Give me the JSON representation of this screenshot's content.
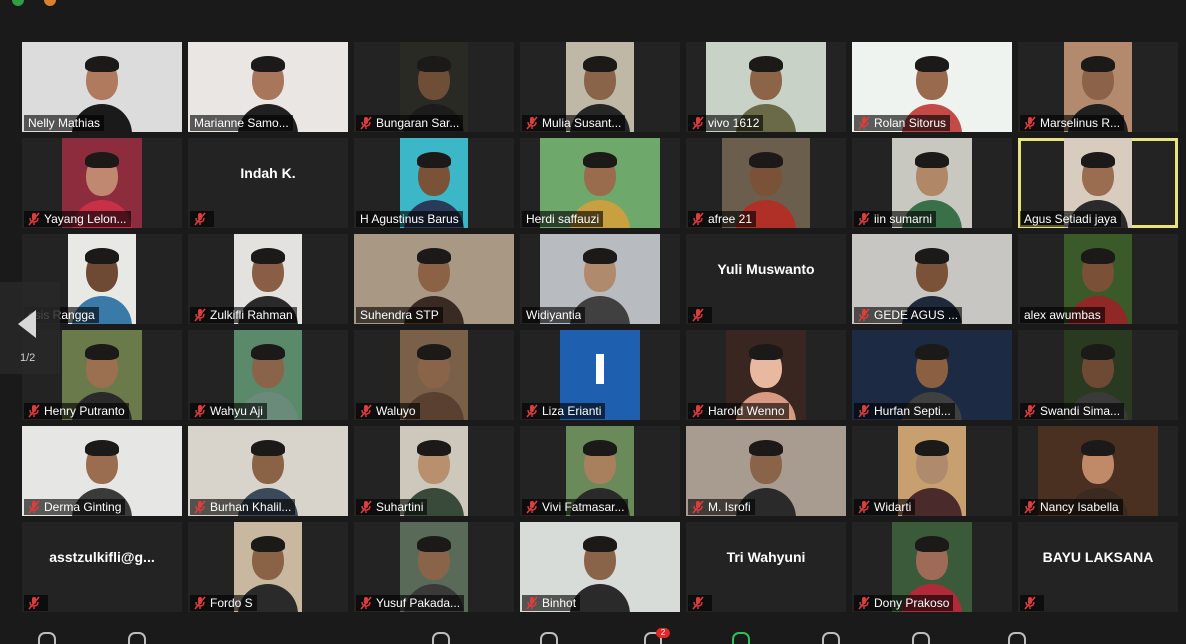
{
  "meeting": {
    "page_indicator": "1/2",
    "badge_count": "2",
    "participants": [
      {
        "name": "Nelly Mathias",
        "muted": false,
        "video": true,
        "bg": "#dcdcdc",
        "skin": "#b07a5e",
        "shirt": "#1a1a1a"
      },
      {
        "name": "Marianne Samo...",
        "muted": false,
        "video": true,
        "bg": "#e9e6e4",
        "skin": "#a8765a",
        "shirt": "#202020"
      },
      {
        "name": "Bungaran Sar...",
        "muted": true,
        "video": true,
        "bg": "#2a2a24",
        "skin": "#6e4e36",
        "shirt": "#1c1c1c"
      },
      {
        "name": "Mulia Susant...",
        "muted": true,
        "video": true,
        "bg": "#bfb8a6",
        "skin": "#8a6448",
        "shirt": "#262626"
      },
      {
        "name": "vivo 1612",
        "muted": true,
        "video": true,
        "bg": "#c9d2c6",
        "skin": "#8c6448",
        "shirt": "#6b6a48"
      },
      {
        "name": "Rolan Sitorus",
        "muted": true,
        "video": true,
        "bg": "#eef3ef",
        "skin": "#9a6a4e",
        "shirt": "#c44a48"
      },
      {
        "name": "Marselinus R...",
        "muted": true,
        "video": true,
        "bg": "#b38a6e",
        "skin": "#8c6248",
        "shirt": "#202020"
      },
      {
        "name": "Yayang Lelon...",
        "muted": true,
        "video": true,
        "bg": "#8c2c3c",
        "skin": "#c08870",
        "shirt": "#c83048"
      },
      {
        "name": "Indah K.",
        "muted": true,
        "video": false
      },
      {
        "name": "H Agustinus Barus",
        "muted": false,
        "video": true,
        "bg": "#3bb7c7",
        "skin": "#7a5238",
        "shirt": "#2a3a58"
      },
      {
        "name": "Herdi saffauzi",
        "muted": false,
        "video": true,
        "bg": "#6ea86a",
        "skin": "#9a6c4e",
        "shirt": "#c8a040"
      },
      {
        "name": "afree 21",
        "muted": true,
        "video": true,
        "bg": "#6c5e4c",
        "skin": "#7a5238",
        "shirt": "#b03028"
      },
      {
        "name": "iin sumarni",
        "muted": true,
        "video": true,
        "bg": "#c8c8c0",
        "skin": "#b08868",
        "shirt": "#3a7048"
      },
      {
        "name": "Agus Setiadi jaya",
        "muted": false,
        "video": true,
        "active": true,
        "bg": "#d8ccbe",
        "skin": "#9a6c50",
        "shirt": "#2a2a2a"
      },
      {
        "name": "esis Rangga",
        "muted": false,
        "video": true,
        "bg": "#e8e8e4",
        "skin": "#6e4a34",
        "shirt": "#3a7aa8"
      },
      {
        "name": "Zulkifli Rahman",
        "muted": true,
        "video": true,
        "bg": "#e4e2de",
        "skin": "#8a5e44",
        "shirt": "#2a2a2a"
      },
      {
        "name": "Suhendra STP",
        "muted": false,
        "video": true,
        "bg": "#a89884",
        "skin": "#8c6246",
        "shirt": "#3a2a24"
      },
      {
        "name": "Widiyantia",
        "muted": false,
        "video": true,
        "bg": "#b8bcc0",
        "skin": "#b08a6c",
        "shirt": "#404040"
      },
      {
        "name": "Yuli Muswanto",
        "muted": true,
        "video": false
      },
      {
        "name": "GEDE AGUS ...",
        "muted": true,
        "video": true,
        "bg": "#c8c6c2",
        "skin": "#7a5238",
        "shirt": "#1e2a3a"
      },
      {
        "name": "alex awumbas",
        "muted": false,
        "video": true,
        "bg": "#3a5a2a",
        "skin": "#7a5036",
        "shirt": "#902828"
      },
      {
        "name": "Henry Putranto",
        "muted": true,
        "video": true,
        "bg": "#6a7a4a",
        "skin": "#9a7050",
        "shirt": "#2a2a2a"
      },
      {
        "name": "Wahyu Aji",
        "muted": true,
        "video": true,
        "bg": "#5a8a6a",
        "skin": "#8a6448",
        "shirt": "#6a8a7a"
      },
      {
        "name": "Waluyo",
        "muted": true,
        "video": true,
        "bg": "#7a6048",
        "skin": "#8a6448",
        "shirt": "#5a4030"
      },
      {
        "name": "Liza Erianti",
        "muted": true,
        "video": true,
        "bg": "#1f5fb0",
        "skin": "#ffffff",
        "shirt": "#1f5fb0",
        "avatar": "I"
      },
      {
        "name": "Harold Wenno",
        "muted": true,
        "video": true,
        "bg": "#3a2620",
        "skin": "#e8b8a0",
        "shirt": "#d89a80"
      },
      {
        "name": "Hurfan Septi...",
        "muted": true,
        "video": true,
        "bg": "#1c2a44",
        "skin": "#8a6040",
        "shirt": "#404040"
      },
      {
        "name": "Swandi Sima...",
        "muted": true,
        "video": true,
        "bg": "#2a3a20",
        "skin": "#6e4a34",
        "shirt": "#3a3a3a"
      },
      {
        "name": "Derma Ginting",
        "muted": true,
        "video": true,
        "bg": "#e6e6e4",
        "skin": "#9a6c50",
        "shirt": "#3a3a3a"
      },
      {
        "name": "Burhan Khalil...",
        "muted": true,
        "video": true,
        "bg": "#d8d4cc",
        "skin": "#8a6246",
        "shirt": "#3a4a5a"
      },
      {
        "name": "Suhartini",
        "muted": true,
        "video": true,
        "bg": "#cec8bc",
        "skin": "#b8906e",
        "shirt": "#3a4a3a"
      },
      {
        "name": "Vivi Fatmasar...",
        "muted": true,
        "video": true,
        "bg": "#6a8a5a",
        "skin": "#a8805e",
        "shirt": "#2a2a2a"
      },
      {
        "name": "M. Isrofi",
        "muted": true,
        "video": true,
        "bg": "#a89c90",
        "skin": "#8a6448",
        "shirt": "#2a2a2a"
      },
      {
        "name": "Widarti",
        "muted": true,
        "video": true,
        "bg": "#c8a070",
        "skin": "#b08a6c",
        "shirt": "#4a2a2a"
      },
      {
        "name": "Nancy Isabella",
        "muted": true,
        "video": true,
        "bg": "#4a3020",
        "skin": "#c08a68",
        "shirt": "#3a2a20"
      },
      {
        "name": "asstzulkifli@g...",
        "muted": true,
        "video": false
      },
      {
        "name": "Fordo S",
        "muted": true,
        "video": true,
        "bg": "#c8b8a0",
        "skin": "#8a6246",
        "shirt": "#2a2a2a"
      },
      {
        "name": "Yusuf Pakada...",
        "muted": true,
        "video": true,
        "bg": "#5a6a58",
        "skin": "#8a6448",
        "shirt": "#3a3a3a"
      },
      {
        "name": "Binhot",
        "muted": true,
        "video": true,
        "bg": "#d8dcd8",
        "skin": "#8a6448",
        "shirt": "#2a2a2a"
      },
      {
        "name": "Tri Wahyuni",
        "muted": true,
        "video": false
      },
      {
        "name": "Dony Prakoso",
        "muted": true,
        "video": true,
        "bg": "#3a5a3a",
        "skin": "#a06a58",
        "shirt": "#b02a3a"
      },
      {
        "name": "BAYU LAKSANA",
        "muted": true,
        "video": false
      }
    ]
  }
}
